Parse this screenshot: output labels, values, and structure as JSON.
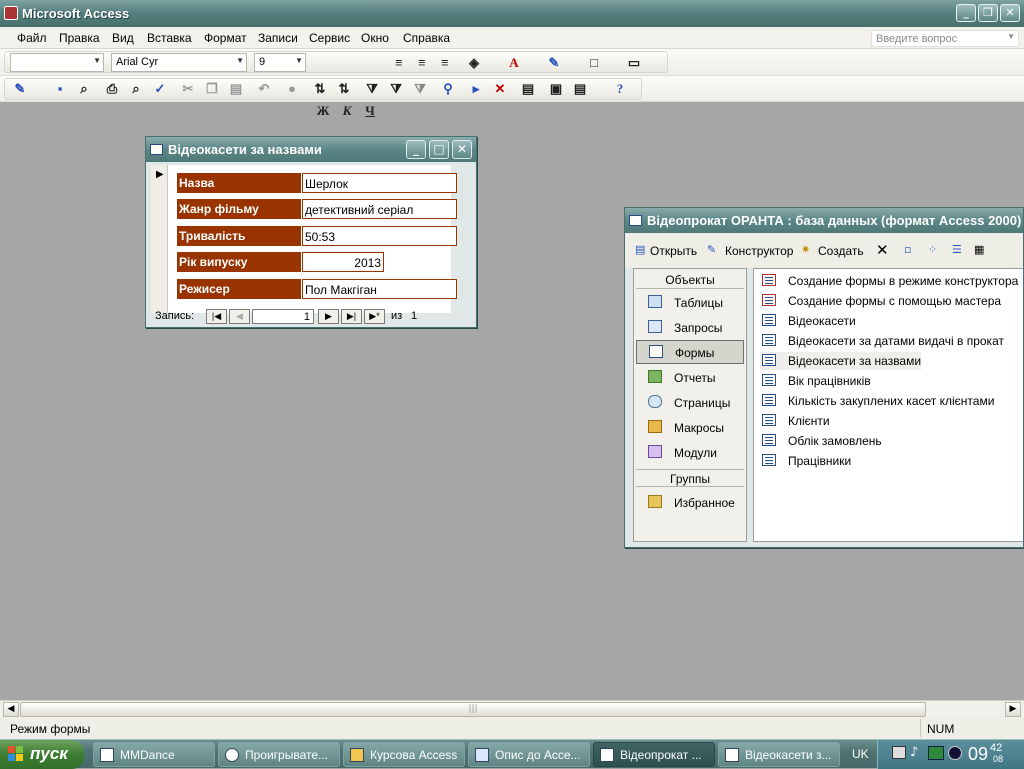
{
  "app": {
    "title": "Microsoft Access"
  },
  "menu": {
    "items": [
      "Файл",
      "Правка",
      "Вид",
      "Вставка",
      "Формат",
      "Записи",
      "Сервис",
      "Окно",
      "Справка"
    ],
    "ask_placeholder": "Введите вопрос"
  },
  "toolbar1": {
    "object_combo": "",
    "font_name": "Arial Cyr",
    "font_size": "9",
    "bold": "Ж",
    "italic": "К",
    "underline": "Ч"
  },
  "form_window": {
    "title": "Відеокасети за назвами",
    "fields": [
      {
        "label": "Назва",
        "value": "Шерлок"
      },
      {
        "label": "Жанр фільму",
        "value": "детективний серіал"
      },
      {
        "label": "Тривалість",
        "value": "50:53"
      },
      {
        "label": "Рік випуску",
        "value": "2013"
      },
      {
        "label": "Режисер",
        "value": "Пол Макгіган"
      }
    ],
    "nav": {
      "label": "Запись:",
      "current": "1",
      "of_label": "из",
      "total": "1"
    }
  },
  "db_window": {
    "title": "Відеопрокат ОРАНТА : база данных (формат Access 2000)",
    "toolbar": {
      "open": "Открыть",
      "design": "Конструктор",
      "create": "Создать"
    },
    "objects_header": "Объекты",
    "objects": [
      "Таблицы",
      "Запросы",
      "Формы",
      "Отчеты",
      "Страницы",
      "Макросы",
      "Модули"
    ],
    "selected_object": "Формы",
    "groups_header": "Группы",
    "groups": [
      "Избранное"
    ],
    "items": [
      "Создание формы в режиме конструктора",
      "Создание формы с помощью мастера",
      "Відеокасети",
      "Відеокасети за датами видачі в прокат",
      "Відеокасети за назвами",
      "Вік працівників",
      "Кількість закуплених касет клієнтами",
      "Клієнти",
      "Облік замовлень",
      "Працівники"
    ]
  },
  "statusbar": {
    "mode": "Режим формы",
    "num": "NUM"
  },
  "taskbar": {
    "start": "пуск",
    "tasks": [
      "MMDance",
      "Проигрывате...",
      "Курсова Access",
      "Опис до Acce...",
      "Відеопрокат ...",
      "Відеокасети з..."
    ],
    "active_task": "Відеопрокат ...",
    "lang": "UK",
    "clock_hours": "09",
    "clock_minutes": "42",
    "clock_seconds": "08"
  },
  "colors": {
    "label_bg": "#993300",
    "title_bar": "#56807f",
    "desktop": "#a6a6a6"
  }
}
